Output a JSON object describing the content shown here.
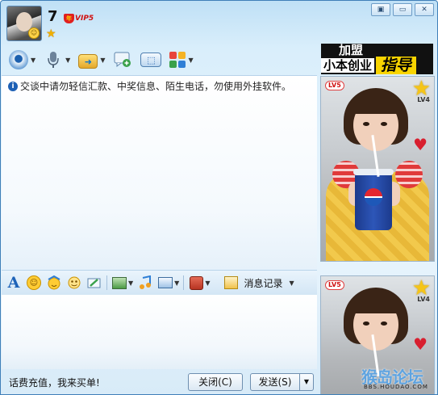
{
  "header": {
    "contact_name": "7",
    "vip_label": "VIP5",
    "vip_badge_glyph": "年",
    "star_glyph": "★",
    "window_controls": [
      "▣",
      "▭",
      "✕"
    ]
  },
  "toolbar": {
    "items": [
      "camera-icon",
      "microphone-icon",
      "send-file-icon",
      "message-icon",
      "screen-share-icon",
      "apps-icon"
    ],
    "apps_colors": [
      "#e8453c",
      "#f5b324",
      "#3aa14b",
      "#2f7fd6"
    ]
  },
  "ad_banner": {
    "line1": "加盟",
    "line2a": "小本创业",
    "line2b": "指导"
  },
  "chat": {
    "notice": "交谈中请勿轻信汇款、中奖信息、陌生电话，勿使用外挂软件。"
  },
  "profile_show": {
    "level_badge": "LV5",
    "level_star": "LV4"
  },
  "format_bar": {
    "history_label": "消息记录"
  },
  "bottom": {
    "ad_text": "话费充值，我来买单!",
    "close_label": "关闭(C)",
    "send_label": "发送(S)",
    "dropdown_glyph": "▼"
  },
  "watermark": {
    "text": "猴岛论坛",
    "url": "BBS.HOUDAO.COM"
  }
}
